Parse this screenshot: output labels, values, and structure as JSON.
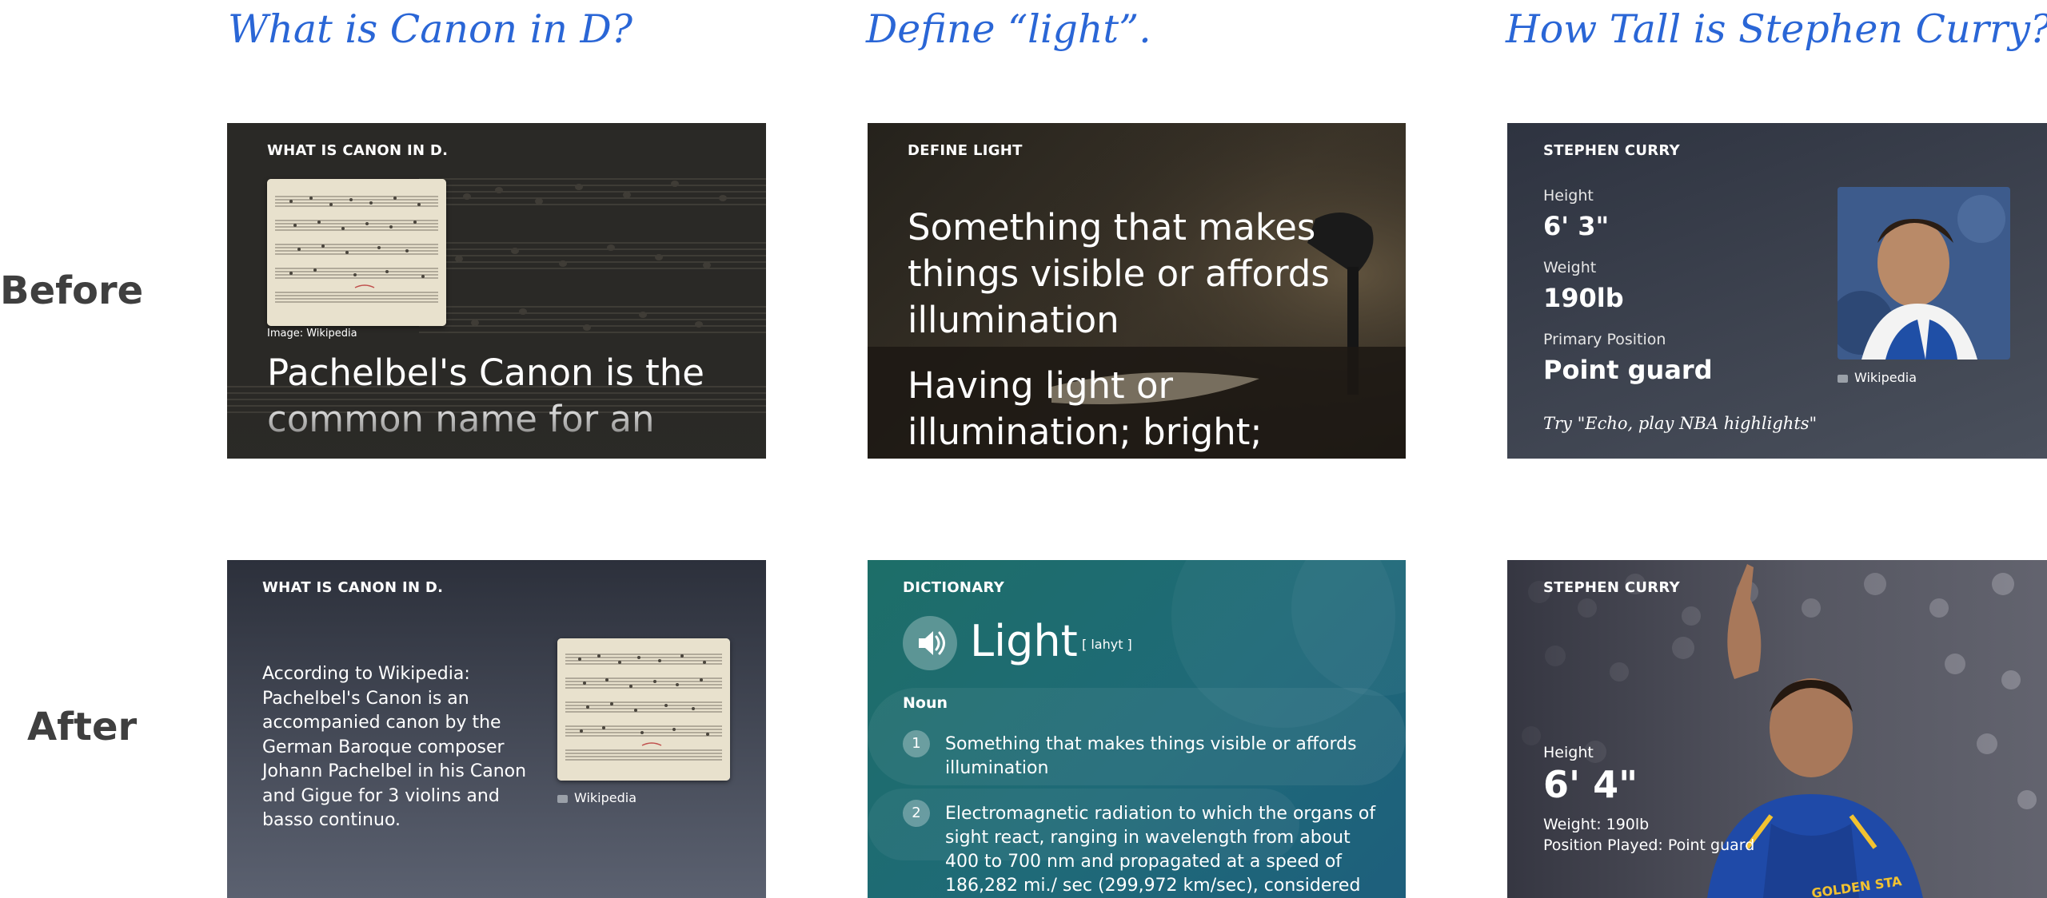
{
  "questions": [
    "What is Canon in D?",
    "Define “light”.",
    "How Tall is Stephen Curry?"
  ],
  "row_labels": {
    "before": "Before",
    "after": "After"
  },
  "before": {
    "canon": {
      "header": "WHAT IS CANON IN D.",
      "image_credit": "Image: Wikipedia",
      "text_line1": "Pachelbel's Canon is the",
      "text_line2": "common name for an",
      "icon": "sheet-music-image"
    },
    "light": {
      "header": "DEFINE LIGHT",
      "definition_1": "Something that makes things visible or affords illumination",
      "definition_2": "Having light or illumination; bright;",
      "icon": "desk-lamp-book-image"
    },
    "curry": {
      "header": "STEPHEN CURRY",
      "height_label": "Height",
      "height_value": "6' 3\"",
      "weight_label": "Weight",
      "weight_value": "190lb",
      "position_label": "Primary Position",
      "position_value": "Point guard",
      "image_credit": "Wikipedia",
      "hint": "Try \"Echo, play NBA highlights\"",
      "icon": "player-portrait-image"
    }
  },
  "after": {
    "canon": {
      "header": "WHAT IS CANON IN D.",
      "body": "According to Wikipedia: Pachelbel's Canon is an accompanied canon by the German Baroque composer Johann Pachelbel in his Canon and Gigue for 3 violins and basso continuo.",
      "image_credit": "Wikipedia",
      "icon": "camera-icon"
    },
    "light": {
      "header": "DICTIONARY",
      "word": "Light",
      "pronunciation": "[ lahyt ]",
      "part_of_speech": "Noun",
      "definitions": [
        {
          "num": "1",
          "text": "Something that makes things visible or affords illumination"
        },
        {
          "num": "2",
          "text": "Electromagnetic radiation to which the organs of sight react, ranging in wavelength from about 400 to 700 nm and propagated at a speed of 186,282 mi./ sec (299,972 km/sec), considered variously as a wave,"
        }
      ],
      "icon": "speaker-icon"
    },
    "curry": {
      "header": "STEPHEN CURRY",
      "height_label": "Height",
      "height_value": "6' 4\"",
      "weight_line": "Weight: 190lb",
      "position_line": "Position Played: Point guard",
      "jersey_text": "GOLDEN STA",
      "icon": "player-action-image"
    }
  },
  "colors": {
    "question": "#2a66d6",
    "row_label": "#3f3f3f",
    "dark_card": "#3a3f4b",
    "dictionary_teal": "#1f6f70"
  }
}
